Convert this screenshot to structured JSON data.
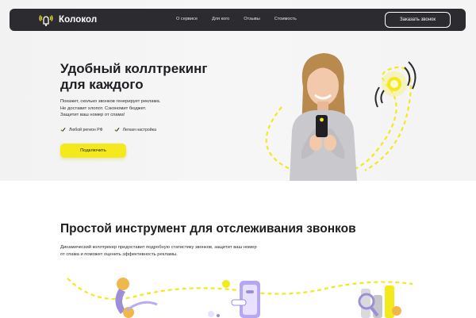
{
  "colors": {
    "accent": "#f3e91c",
    "dark": "#2b2b30",
    "text": "#1d1d22"
  },
  "header": {
    "logo_text": "Колокол",
    "nav": [
      "О сервисе",
      "Для кого",
      "Отзывы",
      "Стоимость"
    ],
    "cta_label": "Заказать звонок"
  },
  "hero": {
    "title_line1": "Удобный коллтрекинг",
    "title_line2": "для каждого",
    "desc_line1": "Покажет, сколько звонков генерирует реклама.",
    "desc_line2": "Не доставит хлопот. Сэкономит бюджет.",
    "desc_line3": "Защитит ваш номер от спама!",
    "features": [
      "Любой регион РФ",
      "Легкая настройка"
    ],
    "button_label": "Подключить"
  },
  "section2": {
    "title": "Простой инструмент для отслеживания звонков",
    "desc_line1": "Динамический коллтрекер предоставит подробную статистику звонков, защитит ваш номер",
    "desc_line2": "от спама и поможет оценить эффективность рекламы."
  },
  "icons": [
    "bell-logo-icon",
    "check-icon",
    "phone-handset-icon",
    "smartphone-chat-icon",
    "chart-magnifier-icon",
    "bell-ringing-icon"
  ]
}
